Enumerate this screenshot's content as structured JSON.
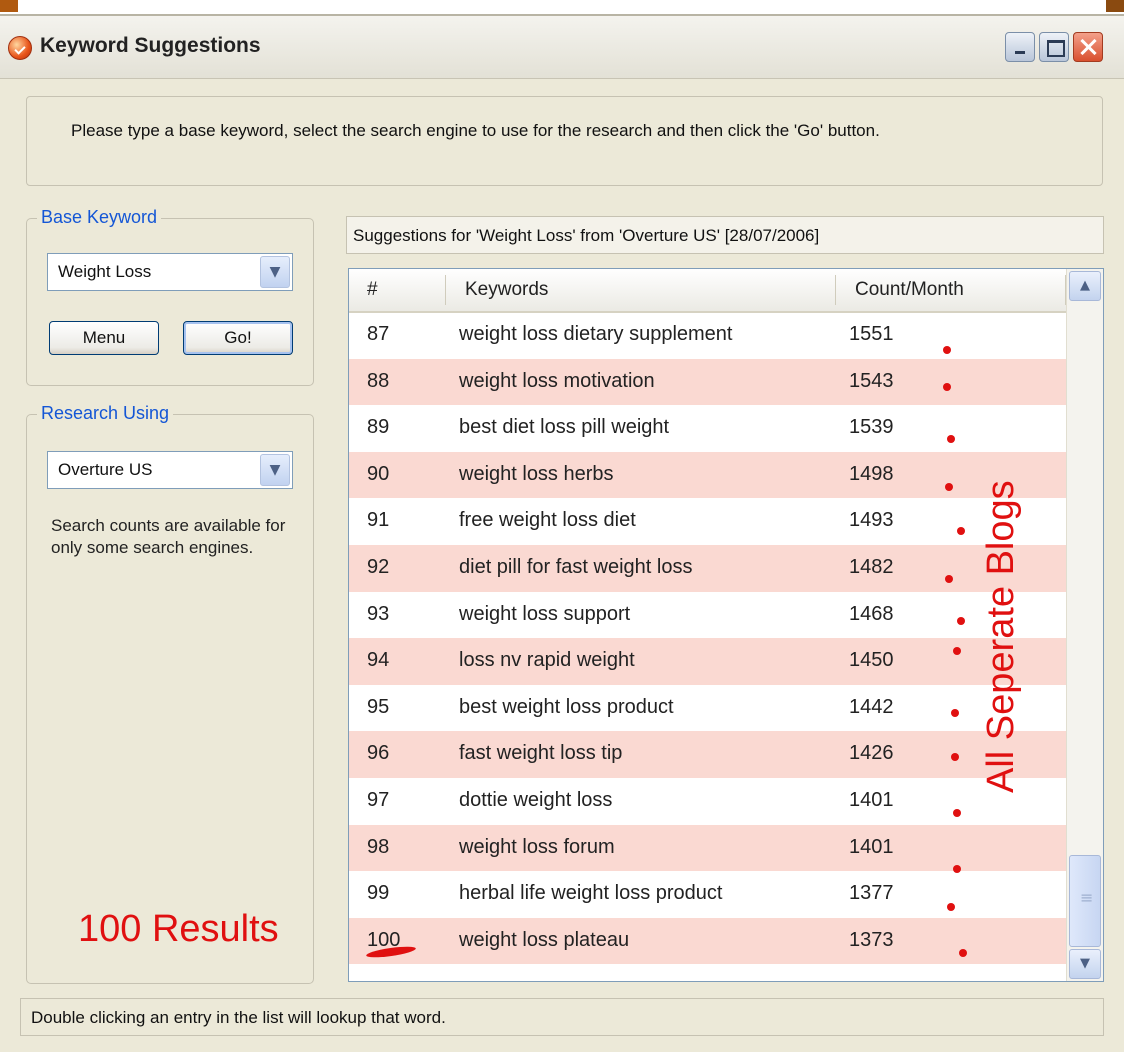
{
  "window": {
    "title": "Keyword Suggestions",
    "controls": [
      "minimize",
      "maximize",
      "close"
    ],
    "accent_color": "#1456d6"
  },
  "instructions": "Please type a base keyword, select the search engine to use for the research and then click the 'Go' button.",
  "base_keyword": {
    "legend": "Base Keyword",
    "value": "Weight Loss",
    "menu_label": "Menu",
    "go_label": "Go!"
  },
  "research": {
    "legend": "Research Using",
    "value": "Overture US",
    "help": "Search counts are available for only some search engines."
  },
  "suggestions_header": "Suggestions for 'Weight Loss' from 'Overture US' [28/07/2006]",
  "list": {
    "columns": [
      "#",
      "Keywords",
      "Count/Month"
    ],
    "rows": [
      {
        "num": "87",
        "keyword": "weight loss dietary supplement",
        "count": "1551"
      },
      {
        "num": "88",
        "keyword": "weight loss motivation",
        "count": "1543"
      },
      {
        "num": "89",
        "keyword": "best diet loss pill weight",
        "count": "1539"
      },
      {
        "num": "90",
        "keyword": "weight loss herbs",
        "count": "1498"
      },
      {
        "num": "91",
        "keyword": "free weight loss diet",
        "count": "1493"
      },
      {
        "num": "92",
        "keyword": "diet pill for fast weight loss",
        "count": "1482"
      },
      {
        "num": "93",
        "keyword": "weight loss support",
        "count": "1468"
      },
      {
        "num": "94",
        "keyword": "loss nv rapid weight",
        "count": "1450"
      },
      {
        "num": "95",
        "keyword": "best weight loss product",
        "count": "1442"
      },
      {
        "num": "96",
        "keyword": "fast weight loss tip",
        "count": "1426"
      },
      {
        "num": "97",
        "keyword": "dottie weight loss",
        "count": "1401"
      },
      {
        "num": "98",
        "keyword": "weight loss forum",
        "count": "1401"
      },
      {
        "num": "99",
        "keyword": "herbal life weight loss product",
        "count": "1377"
      },
      {
        "num": "100",
        "keyword": "weight loss plateau",
        "count": "1373"
      }
    ],
    "alt_row_color": "#fad9d2"
  },
  "status_bar": "Double clicking an entry in the list will lookup that word.",
  "annotations": {
    "results": "100 Results",
    "blogs": "All Seperate Blogs",
    "color": "#e01010"
  }
}
